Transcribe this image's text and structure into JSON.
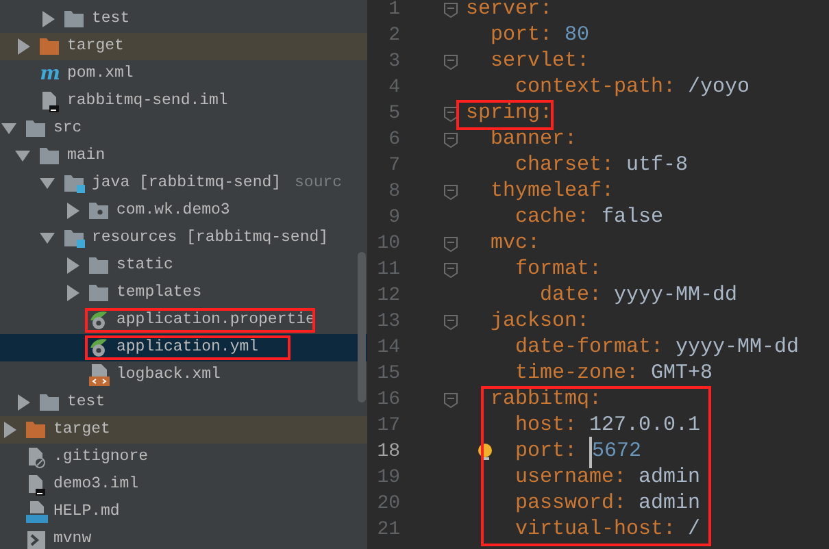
{
  "project_tree": [
    {
      "children": [
        {
          "children": [
            {
              "label": "test",
              "kind": "folder",
              "expanded": false,
              "selected": false
            }
          ]
        },
        {
          "label": "target",
          "kind": "excluded-folder",
          "expanded": false,
          "selected": false
        },
        {
          "label": "pom.xml",
          "kind": "maven-file",
          "icon_text": "m",
          "selected": false
        },
        {
          "label": "rabbitmq-send.iml",
          "kind": "iml-file",
          "selected": false
        }
      ]
    },
    {
      "label": "src",
      "kind": "folder",
      "expanded": true,
      "selected": false,
      "children": [
        {
          "label": "main",
          "kind": "folder",
          "expanded": true,
          "selected": false,
          "children": [
            {
              "label": "java [rabbitmq-send]",
              "hint": "sourc",
              "kind": "source-folder",
              "expanded": true,
              "selected": false,
              "children": [
                {
                  "label": "com.wk.demo3",
                  "kind": "package",
                  "expanded": false,
                  "selected": false
                }
              ]
            },
            {
              "label": "resources [rabbitmq-send]",
              "kind": "source-folder",
              "expanded": true,
              "selected": false,
              "children": [
                {
                  "label": "static",
                  "kind": "folder",
                  "expanded": false,
                  "selected": false
                },
                {
                  "label": "templates",
                  "kind": "folder",
                  "expanded": false,
                  "selected": false
                },
                {
                  "label": "application.propertie",
                  "kind": "spring-file",
                  "selected": false,
                  "marked": true
                },
                {
                  "label": "application.yml",
                  "kind": "spring-file",
                  "selected": true,
                  "marked": true
                },
                {
                  "label": "logback.xml",
                  "kind": "xml-file",
                  "selected": false
                }
              ]
            }
          ]
        },
        {
          "label": "test",
          "kind": "folder",
          "expanded": false,
          "selected": false
        }
      ]
    },
    {
      "label": "target",
      "kind": "excluded-folder",
      "expanded": false,
      "selected": false
    },
    {
      "label": ".gitignore",
      "kind": "ignore-file",
      "selected": false
    },
    {
      "label": "demo3.iml",
      "kind": "iml-file",
      "selected": false
    },
    {
      "label": "HELP.md",
      "kind": "md-file",
      "selected": false
    },
    {
      "label": "mvnw",
      "kind": "script-file",
      "selected": false
    }
  ],
  "editor": {
    "lines": [
      {
        "number": "1",
        "key": "server:",
        "children": [
          {
            "number": "2",
            "key": "port:",
            "value": "80",
            "kind": "number"
          },
          {
            "number": "3",
            "key": "servlet:",
            "children": [
              {
                "number": "4",
                "key": "context-path:",
                "value": "/yoyo",
                "kind": "string"
              }
            ]
          }
        ]
      },
      {
        "number": "5",
        "key": "spring:",
        "marked": true,
        "children": [
          {
            "number": "6",
            "key": "banner:",
            "children": [
              {
                "number": "7",
                "key": "charset:",
                "value": "utf-8",
                "kind": "string"
              }
            ]
          },
          {
            "number": "8",
            "key": "thymeleaf:",
            "children": [
              {
                "number": "9",
                "key": "cache:",
                "value": "false",
                "kind": "string"
              }
            ]
          },
          {
            "number": "10",
            "key": "mvc:",
            "children": [
              {
                "number": "11",
                "key": "format:",
                "children": [
                  {
                    "number": "12",
                    "key": "date:",
                    "value": "yyyy-MM-dd",
                    "kind": "string"
                  }
                ]
              }
            ]
          },
          {
            "number": "13",
            "key": "jackson:",
            "children": [
              {
                "number": "14",
                "key": "date-format:",
                "value": "yyyy-MM-dd",
                "kind": "string"
              },
              {
                "number": "15",
                "key": "time-zone:",
                "value": "GMT+8",
                "kind": "string"
              }
            ]
          },
          {
            "number": "16",
            "key": "rabbitmq:",
            "marked": true,
            "children": [
              {
                "number": "17",
                "key": "host:",
                "value": "127.0.0.1",
                "kind": "string"
              },
              {
                "number": "18",
                "key": "port:",
                "value": "5672",
                "kind": "number",
                "current": true
              },
              {
                "number": "19",
                "key": "username:",
                "value": "admin",
                "kind": "string"
              },
              {
                "number": "20",
                "key": "password:",
                "value": "admin",
                "kind": "string"
              },
              {
                "number": "21",
                "key": "virtual-host:",
                "value": "/",
                "kind": "string"
              }
            ]
          }
        ]
      }
    ]
  }
}
